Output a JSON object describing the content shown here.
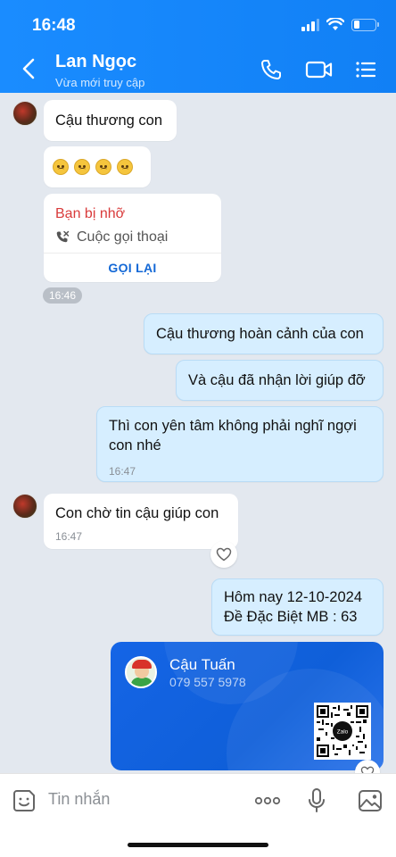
{
  "status_bar": {
    "time": "16:48"
  },
  "header": {
    "contact_name": "Lan Ngọc",
    "status": "Vừa mới truy cập",
    "icons": [
      "back-icon",
      "phone-icon",
      "video-call-icon",
      "menu-list-icon"
    ]
  },
  "messages": {
    "m1": {
      "text": "Cậu thương con"
    },
    "m2": {
      "emojis": [
        "crying-face",
        "crying-face",
        "crying-face",
        "crying-face"
      ]
    },
    "m3": {
      "missed_label": "Bạn bị nhỡ",
      "call_label": "Cuộc gọi thoại",
      "callback_label": "GỌI LẠI"
    },
    "t1": "16:46",
    "m4": {
      "text": "Cậu thương hoàn cảnh của con"
    },
    "m5": {
      "text": "Và cậu đã nhận lời giúp đỡ"
    },
    "m6": {
      "line1": "Thì con yên tâm không phải nghĩ ngợi",
      "line2": "con nhé",
      "time": "16:47"
    },
    "m7": {
      "text": "Con chờ tin cậu giúp con",
      "time": "16:47"
    },
    "m8": {
      "line1": "Hôm nay 12-10-2024",
      "line2": "Đề Đặc Biệt MB : 63"
    },
    "contact_card": {
      "name": "Cậu Tuấn",
      "phone": "079 557 5978",
      "qr_label": "Zalo"
    }
  },
  "input_bar": {
    "placeholder": "Tin nhắn"
  },
  "colors": {
    "header": "#1a8cff",
    "chat_bg": "#e3e8ef",
    "my_bubble": "#d6eeff",
    "missed": "#d93b3b",
    "card": "#1565e6"
  }
}
